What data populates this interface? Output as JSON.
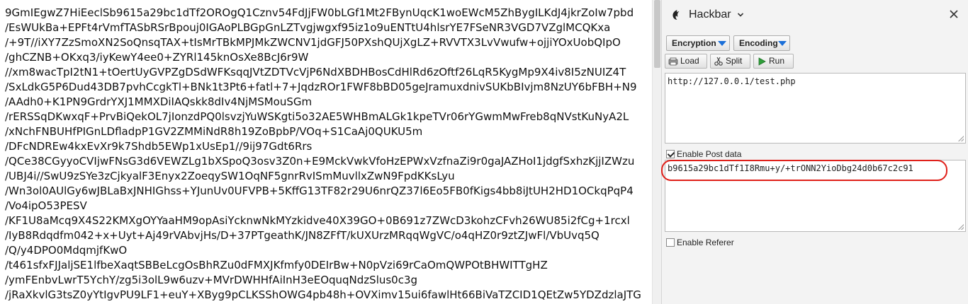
{
  "left_text": {
    "lines": [
      "9GmIEgwZ7HiEeclSb9615a29bc1dTf2OROgQ1Cznv54FdJjFW0bLGf1Mt2FBynUqcK1woEWcM5ZhBygILKdJ4jkrZoIw7pbd",
      "/EsWUkBa+EPFt4rVmfTASbRSrBpouj0IGAoPLBGpGnLZTvgjwgxf95iz1o9uENTtU4hlsrYE7FSeNR3VGD7VZglMCQKxa",
      "/+9T//iXY7ZzSmoXN2SoQnsqTAX+tIsMrTBkMPJMkZWCNV1jdGFJ50PXshQUjXgLZ+RVVTX3LvVwufw+ojjiYOxUobQIpO",
      "/ghCZNB+OKxq3/iyKewY4ee0+ZYRl145knOsXe8BcJ6r9W",
      "//xm8wacTpI2tN1+tOertUyGVPZgDSdWFKsqqJVtZDTVcVjP6NdXBDHBosCdHlRd6zOftf26LqR5KygMp9X4iv8I5zNUIZ4T",
      "/SxLdkG5P6Dud43DB7pvhCcgkTl+BNk1t3Pt6+fatl+7+JqdzROr1FWF8bBD05geJramuxdnivSUKbBIvjm8NzUY6bFBH+N9",
      "/AAdh0+K1PN9GrdrYXJ1MMXDiIAQskk8dIv4NjMSMouSGm",
      "/rERSSqDKwxqF+PrvBiQekOL7jIonzdPQ0lsvzjYuWSKgti5o32AE5WHBmALGk1kpeTVr06rYGwmMwFreb8qNVstKuNyA2L",
      "/xNchFNBUHfPIGnLDfladpP1GV2ZMMiNdR8h19ZoBpbP/VOq+S1CaAj0QUKU5m",
      "/DFcNDREw4kxEvXr9k7Shdb5EWp1xUsEp1//9ij97Gdt6Rrs",
      "/QCe38CGyyoCVIjwFNsG3d6VEWZLg1bXSpoQ3osv3Z0n+E9MckVwkVfoHzEPWxVzfnaZi9r0gaJAZHoI1jdgfSxhzKjjIZWzu",
      "/UBJ4i//SwU9zSYe3zCjkyalF3Enyx2ZoeqySW1OqNF5gnrRvISmMuvllxZwN9FpdKKsLyu",
      "/Wn3ol0AUlGy6wJBLaBxJNHIGhss+YJunUv0UFVPB+5KffG13TF82r29U6nrQZ37l6Eo5FB0fKigs4bb8iJtUH2HD1OCkqPqP4",
      "/Vo4ipO53PESV",
      "/KF1U8aMcq9X4S22KMXgOYYaaHM9opAsiYcknwNkMYzkidve40X39GO+0B691z7ZWcD3kohzCFvh26WU85i2fCg+1rcxl",
      "/IyB8Rdqdfm042+x+Uyt+Aj49rVAbvjHs/D+37PTgeathK/JN8ZFfT/kUXUrzMRqqWgVC/o4qHZ0r9ztZJwFl/VbUvq5Q",
      "/Q/y4DPO0MdqmjfKwO",
      "/t461sfxFJJaljSE1lfbeXaqtSBBeLcgOsBhRZu0dFMXJKfmfy0DEIrBw+N0pVzi69rCaOmQWPOtBHWITTgHZ",
      "/ymFEnbvLwrT5YchY/zg5i3olL9w6uzv+MVrDWHHfAiInH3eEOquqNdzSlus0c3g",
      "/jRaXkvlG3tsZ0yYtIgvPU9LF1+euY+XByg9pCLKSShOWG4pb48h+OVXimv15ui6fawlHt66BiVaTZCID1QEtZw5YDZdzlaJTG"
    ]
  },
  "hackbar": {
    "title": "Hackbar",
    "menus": {
      "encryption": "Encryption",
      "encoding": "Encoding"
    },
    "buttons": {
      "load": "Load",
      "split": "Split",
      "run": "Run"
    },
    "url_value": "http://127.0.0.1/test.php",
    "enable_post_label": "Enable Post data",
    "enable_post_checked": true,
    "post_value": "b9615a29bc1dTf1I8Rmu+y/+trONN2YioDbg24d0b67c2c91",
    "enable_referer_label": "Enable Referer",
    "enable_referer_checked": false,
    "icons": [
      "hackbar-logo-icon",
      "chevron-down-icon",
      "close-icon",
      "load-icon",
      "split-icon",
      "run-icon"
    ]
  },
  "colors": {
    "highlight": "#e0201a",
    "dropdown_arrow": "#1a6fd8"
  }
}
